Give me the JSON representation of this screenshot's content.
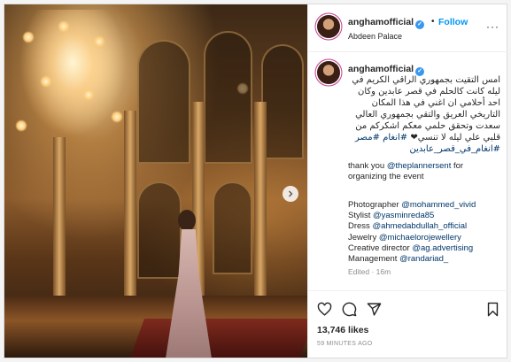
{
  "post": {
    "image_alt": "Woman in a long mauve gown in an ornate palace hall",
    "next_icon": "chevron-right-icon"
  },
  "header": {
    "username": "anghamofficial",
    "verified_icon": "verified-badge-icon",
    "dot": "•",
    "follow_label": "Follow",
    "location": "Abdeen Palace",
    "more_label": "···"
  },
  "caption": {
    "username": "anghamofficial",
    "arabic_text": "امس التقيت بجمهوري الراقي الكريم في ليله كانت كالحلم في قصر عابدين وكان احد أحلامي ان اغني في هذا المكان التاريخي العريق والتقي بجمهوري العالي سعدت وتحقق حلمي معكم اشكركم من قلبي علي ليله لا تنسي",
    "arabic_heart": "❤",
    "hashtags": "#انغام #مصر #انغام_في_قصر_عابدين",
    "thanks_prefix": "thank you ",
    "thanks_mention": "@theplannersent",
    "thanks_suffix": " for organizing the event",
    "credits": [
      {
        "role": "Photographer ",
        "handle": "@mohammed_vivid"
      },
      {
        "role": "Stylist ",
        "handle": "@yasminreda85"
      },
      {
        "role": "Dress ",
        "handle": "@ahmedabdullah_official"
      },
      {
        "role": "Jewelry ",
        "handle": "@michaelorojewellery"
      },
      {
        "role": "Creative director ",
        "handle": "@ag.advertising"
      },
      {
        "role": "Management ",
        "handle": "@randariad_"
      }
    ],
    "edited": "Edited · 16m"
  },
  "actions": {
    "like_icon": "heart-icon",
    "comment_icon": "comment-icon",
    "share_icon": "share-icon",
    "save_icon": "bookmark-icon"
  },
  "likes": "13,746 likes",
  "time": "59 MINUTES AGO",
  "colors": {
    "link": "#0095f6",
    "mention": "#00376b",
    "muted": "#8e8e8e",
    "verified": "#3897f0"
  }
}
